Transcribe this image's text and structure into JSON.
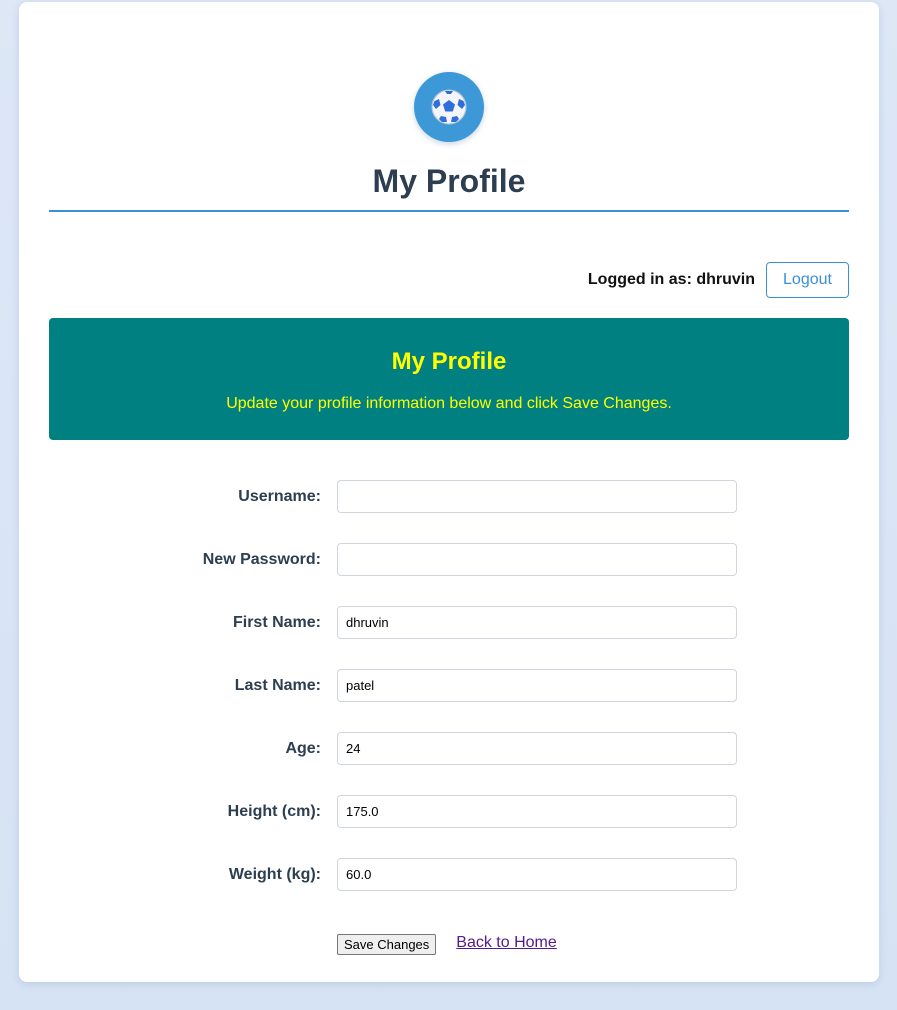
{
  "header": {
    "logo_icon": "soccer-ball-icon",
    "title": "My Profile"
  },
  "user_bar": {
    "logged_in_text": "Logged in as: dhruvin",
    "logout_label": "Logout"
  },
  "banner": {
    "title": "My Profile",
    "text": "Update your profile information below and click Save Changes.",
    "background_color": "#008080",
    "text_color": "#ffff00"
  },
  "form": {
    "fields": [
      {
        "label": "Username:",
        "value": ""
      },
      {
        "label": "New Password:",
        "value": ""
      },
      {
        "label": "First Name:",
        "value": "dhruvin"
      },
      {
        "label": "Last Name:",
        "value": "patel"
      },
      {
        "label": "Age:",
        "value": "24"
      },
      {
        "label": "Height (cm):",
        "value": "175.0"
      },
      {
        "label": "Weight (kg):",
        "value": "60.0"
      }
    ],
    "save_label": "Save Changes",
    "back_link": "Back to Home"
  },
  "colors": {
    "accent": "#3a8fd6",
    "title": "#2c3e50"
  }
}
